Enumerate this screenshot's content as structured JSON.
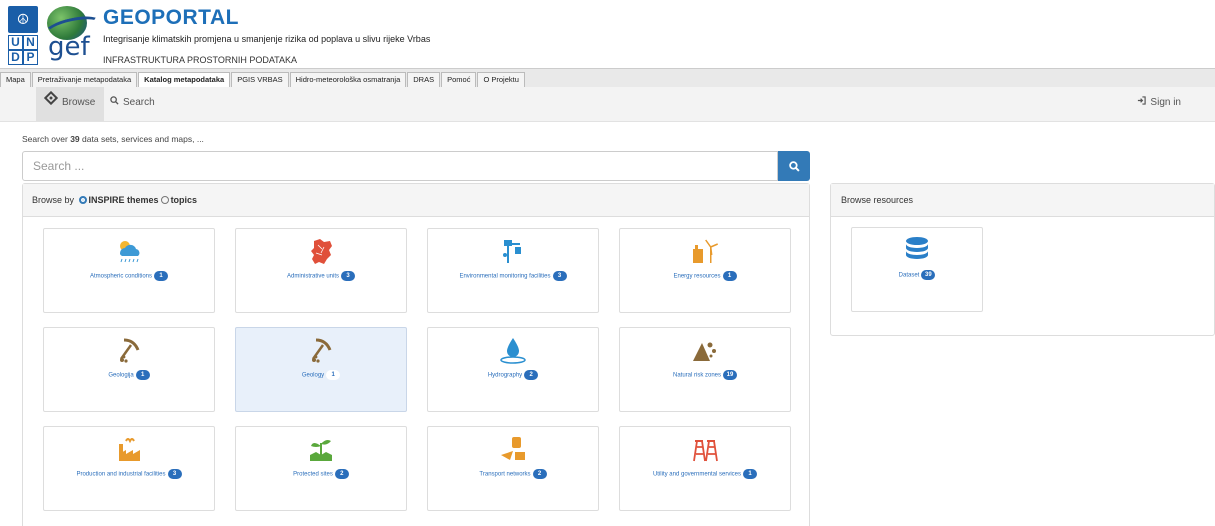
{
  "header": {
    "undp_top": "☮",
    "undp_letters": [
      "U",
      "N",
      "D",
      "P"
    ],
    "gef_text": "gef",
    "title": "GEOPORTAL",
    "subtitle": "Integrisanje klimatskih promjena u smanjenje rizika od poplava u slivu rijeke Vrbas",
    "infra": "INFRASTRUKTURA PROSTORNIH PODATAKA"
  },
  "menu_tabs": [
    "Mapa",
    "Pretraživanje metapodataka",
    "Katalog metapodataka",
    "PGIS VRBAS",
    "Hidro-meteorološka osmatranja",
    "DRAS",
    "Pomoć",
    "O Projektu"
  ],
  "active_menu_tab": "Katalog metapodataka",
  "nav": {
    "browse": "Browse",
    "search": "Search",
    "signin": "Sign in"
  },
  "count_line": {
    "pre": "Search over ",
    "count": "39",
    "post": " data sets, services and maps, ..."
  },
  "search": {
    "placeholder": "Search ..."
  },
  "browse_by": {
    "label": "Browse by ",
    "option1": "INSPIRE themes",
    "option2": "topics"
  },
  "themes": [
    {
      "name": "atmospheric-conditions",
      "label": "Atmospheric conditions",
      "count": "1",
      "icon": "cloud-rain",
      "color": "#3d9ad6"
    },
    {
      "name": "administrative-units",
      "label": "Administrative units",
      "count": "3",
      "icon": "map-europe",
      "color": "#e0503a"
    },
    {
      "name": "environmental-monitoring",
      "label": "Environmental monitoring facilities",
      "count": "3",
      "icon": "monitoring-station",
      "color": "#2a8fd0"
    },
    {
      "name": "energy-resources",
      "label": "Energy resources",
      "count": "1",
      "icon": "wind-turbine",
      "color": "#e89a2c"
    },
    {
      "name": "geologija",
      "label": "Geologija",
      "count": "1",
      "icon": "pickaxe",
      "color": "#8a6a3a"
    },
    {
      "name": "geology",
      "label": "Geology",
      "count": "1",
      "icon": "pickaxe",
      "color": "#8a6a3a"
    },
    {
      "name": "hydrography",
      "label": "Hydrography",
      "count": "2",
      "icon": "water-drop",
      "color": "#2a8fd0"
    },
    {
      "name": "natural-risk-zones",
      "label": "Natural risk zones",
      "count": "19",
      "icon": "rockfall",
      "color": "#8a6a3a"
    },
    {
      "name": "production-industrial",
      "label": "Production and industrial facilities",
      "count": "3",
      "icon": "factory",
      "color": "#e89a2c"
    },
    {
      "name": "protected-sites",
      "label": "Protected sites",
      "count": "2",
      "icon": "plant",
      "color": "#5aa83c"
    },
    {
      "name": "transport-networks",
      "label": "Transport networks",
      "count": "2",
      "icon": "transport",
      "color": "#e89a2c"
    },
    {
      "name": "utility-services",
      "label": "Utility and governmental services",
      "count": "1",
      "icon": "utility-tower",
      "color": "#e0503a"
    }
  ],
  "resources": {
    "title": "Browse resources",
    "item_label": "Dataset",
    "item_count": "39",
    "icon": "database",
    "color": "#2a7fc8"
  }
}
